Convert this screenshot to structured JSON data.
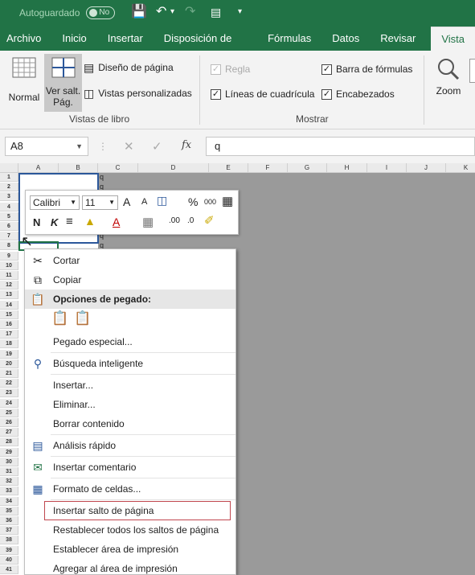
{
  "titlebar": {
    "autosave_label": "Autoguardado",
    "autosave_state": "No"
  },
  "tabs": [
    "Archivo",
    "Inicio",
    "Insertar",
    "Disposición de página",
    "Fórmulas",
    "Datos",
    "Revisar",
    "Vista"
  ],
  "ribbon": {
    "normal": "Normal",
    "page_break": "Ver salt. Pág.",
    "page_layout": "Diseño de página",
    "custom_views": "Vistas personalizadas",
    "group_views": "Vistas de libro",
    "ruler": "Regla",
    "formula_bar": "Barra de fórmulas",
    "gridlines": "Líneas de cuadrícula",
    "headings": "Encabezados",
    "group_show": "Mostrar",
    "zoom": "Zoom"
  },
  "formula": {
    "name_box": "A8",
    "fx": "fx",
    "value": "q"
  },
  "columns": [
    "A",
    "B",
    "C",
    "D",
    "E",
    "F",
    "G",
    "H",
    "I",
    "J",
    "K"
  ],
  "rows": [
    "1",
    "2",
    "3",
    "4",
    "5",
    "6",
    "7",
    "8",
    "9",
    "10",
    "11",
    "12",
    "13",
    "14",
    "15",
    "16",
    "17",
    "18",
    "19",
    "20",
    "21",
    "22",
    "23",
    "24",
    "25",
    "26",
    "27",
    "28",
    "29",
    "30",
    "31",
    "32",
    "33",
    "34",
    "35",
    "36",
    "37",
    "38",
    "39",
    "40",
    "41"
  ],
  "cell_q": "q",
  "mini": {
    "font": "Calibri",
    "size": "11",
    "bold": "N",
    "italic": "K",
    "percent": "%",
    "thousands": "000",
    "a_big": "A",
    "a_small": "A",
    "font_color": "A"
  },
  "menu": {
    "cut": "Cortar",
    "copy": "Copiar",
    "paste_options": "Opciones de pegado:",
    "paste_special": "Pegado especial...",
    "smart_lookup": "Búsqueda inteligente",
    "insert": "Insertar...",
    "delete": "Eliminar...",
    "clear": "Borrar contenido",
    "quick_analysis": "Análisis rápido",
    "insert_comment": "Insertar comentario",
    "format_cells": "Formato de celdas...",
    "insert_break": "Insertar salto de página",
    "reset_breaks": "Restablecer todos los saltos de página",
    "set_print_area": "Establecer área de impresión",
    "add_print_area": "Agregar al área de impresión"
  }
}
